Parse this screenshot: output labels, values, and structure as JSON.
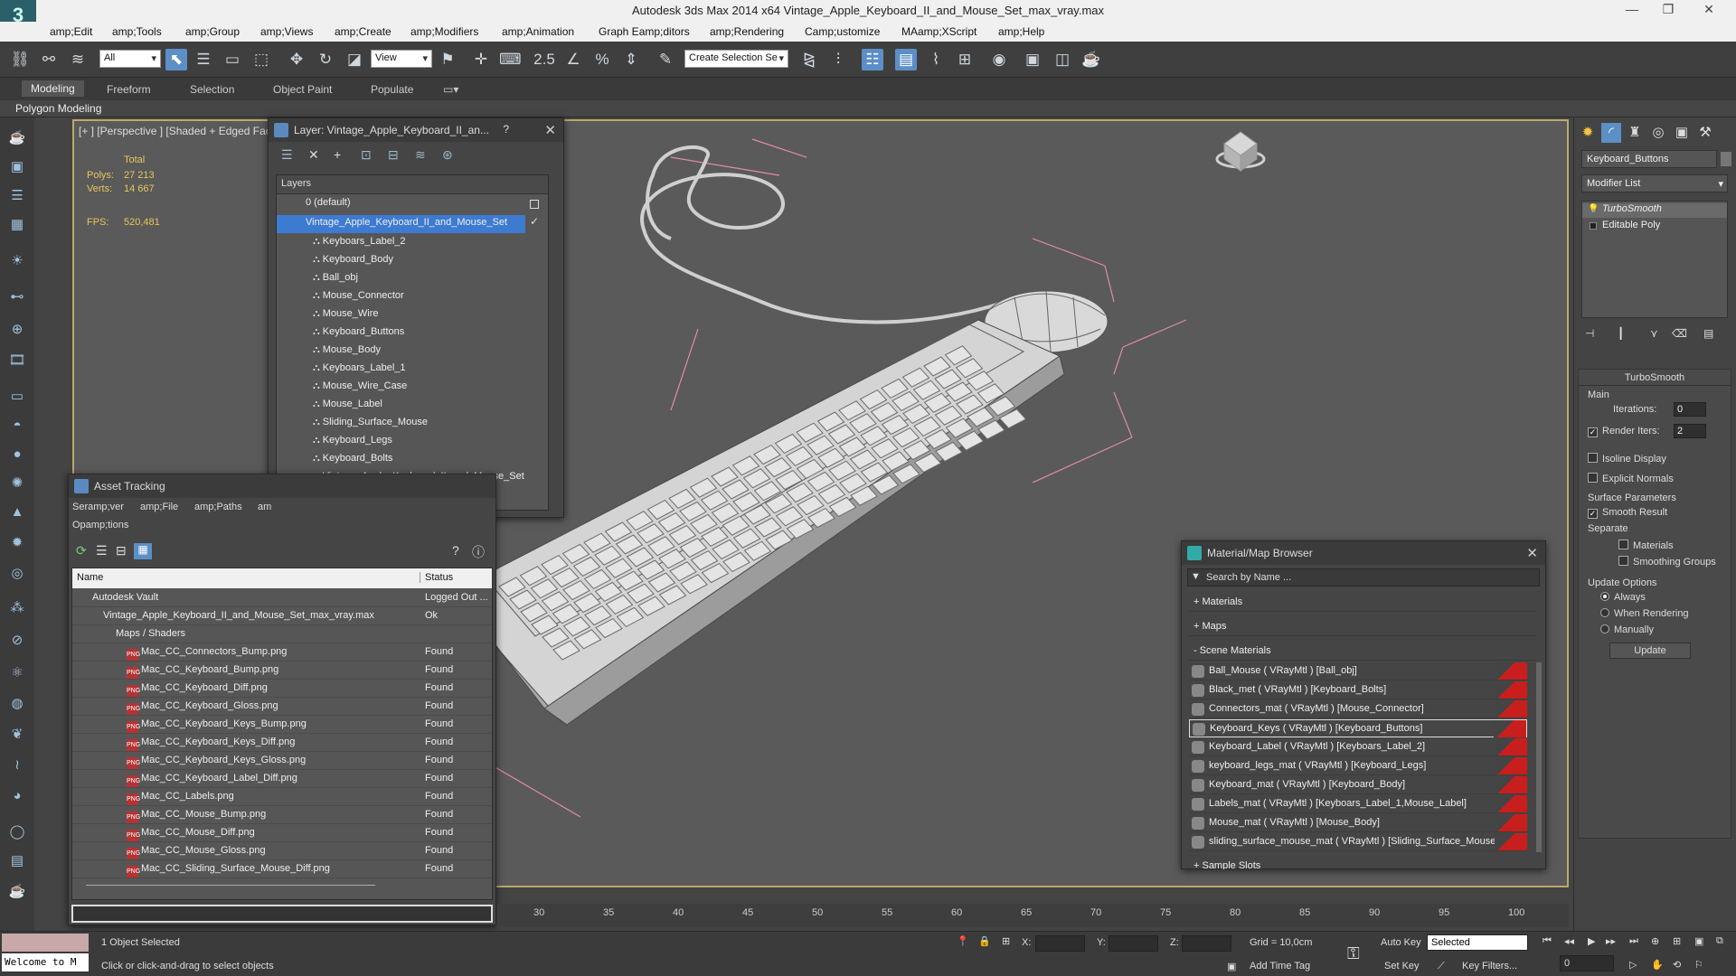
{
  "window": {
    "title": "Autodesk 3ds Max  2014 x64      Vintage_Apple_Keyboard_II_and_Mouse_Set_max_vray.max",
    "logo": "3",
    "min": "—",
    "restore": "❐",
    "close": "✕"
  },
  "menu": [
    "amp;Edit",
    "amp;Tools",
    "amp;Group",
    "amp;Views",
    "amp;Create",
    "amp;Modifiers",
    "amp;Animation",
    "Graph Eamp;ditors",
    "amp;Rendering",
    "Camp;ustomize",
    "MAamp;XScript",
    "amp;Help"
  ],
  "toolbar": {
    "filter_select": "All",
    "refcoord_select": "View",
    "selection_set": "Create Selection Se",
    "snap_angle": "2.5"
  },
  "ribbon": {
    "tabs": [
      "Modeling",
      "Freeform",
      "Selection",
      "Object Paint",
      "Populate"
    ],
    "active_tab": "Modeling",
    "sub_title": "Polygon Modeling"
  },
  "viewport": {
    "label": "[+ ] [Perspective ] [Shaded + Edged Faces ]",
    "stats": {
      "total_label": "Total",
      "polys_label": "Polys:",
      "polys_value": "27 213",
      "verts_label": "Verts:",
      "verts_value": "14 667",
      "fps_label": "FPS:",
      "fps_value": "520,481"
    }
  },
  "layer_dialog": {
    "title": "Layer: Vintage_Apple_Keyboard_II_an...",
    "help": "?",
    "close": "✕",
    "header": "Layers",
    "default_layer": "0 (default)",
    "selected_layer": "Vintage_Apple_Keyboard_II_and_Mouse_Set",
    "objects": [
      "Keyboars_Label_2",
      "Keyboard_Body",
      "Ball_obj",
      "Mouse_Connector",
      "Mouse_Wire",
      "Keyboard_Buttons",
      "Mouse_Body",
      "Keyboars_Label_1",
      "Mouse_Wire_Case",
      "Mouse_Label",
      "Sliding_Surface_Mouse",
      "Keyboard_Legs",
      "Keyboard_Bolts",
      "Vintage_Apple_Keyboard_II_and_Mouse_Set"
    ]
  },
  "asset_tracking": {
    "title": "Asset Tracking",
    "menu": [
      "Seramp;ver",
      "amp;File",
      "amp;Paths",
      "am"
    ],
    "menu2": "Opamp;tions",
    "col_name": "Name",
    "col_status": "Status",
    "rows": [
      {
        "name": "Autodesk Vault",
        "status": "Logged Out ..."
      },
      {
        "name": "Vintage_Apple_Keyboard_II_and_Mouse_Set_max_vray.max",
        "status": "Ok"
      },
      {
        "name": "Maps / Shaders",
        "status": ""
      },
      {
        "name": "Mac_CC_Connectors_Bump.png",
        "status": "Found"
      },
      {
        "name": "Mac_CC_Keyboard_Bump.png",
        "status": "Found"
      },
      {
        "name": "Mac_CC_Keyboard_Diff.png",
        "status": "Found"
      },
      {
        "name": "Mac_CC_Keyboard_Gloss.png",
        "status": "Found"
      },
      {
        "name": "Mac_CC_Keyboard_Keys_Bump.png",
        "status": "Found"
      },
      {
        "name": "Mac_CC_Keyboard_Keys_Diff.png",
        "status": "Found"
      },
      {
        "name": "Mac_CC_Keyboard_Keys_Gloss.png",
        "status": "Found"
      },
      {
        "name": "Mac_CC_Keyboard_Label_Diff.png",
        "status": "Found"
      },
      {
        "name": "Mac_CC_Labels.png",
        "status": "Found"
      },
      {
        "name": "Mac_CC_Mouse_Bump.png",
        "status": "Found"
      },
      {
        "name": "Mac_CC_Mouse_Diff.png",
        "status": "Found"
      },
      {
        "name": "Mac_CC_Mouse_Gloss.png",
        "status": "Found"
      },
      {
        "name": "Mac_CC_Sliding_Surface_Mouse_Diff.png",
        "status": "Found"
      }
    ]
  },
  "material_browser": {
    "title": "Material/Map Browser",
    "search_placeholder": "Search by Name ...",
    "sections": [
      "+ Materials",
      "+ Maps",
      "- Scene Materials"
    ],
    "materials": [
      "Ball_Mouse ( VRayMtl ) [Ball_obj]",
      "Black_met ( VRayMtl ) [Keyboard_Bolts]",
      "Connectors_mat ( VRayMtl ) [Mouse_Connector]",
      "Keyboard_Keys ( VRayMtl ) [Keyboard_Buttons]",
      "Keyboard_Label ( VRayMtl ) [Keyboars_Label_2]",
      "keyboard_legs_mat ( VRayMtl ) [Keyboard_Legs]",
      "Keyboard_mat ( VRayMtl ) [Keyboard_Body]",
      "Labels_mat ( VRayMtl ) [Keyboars_Label_1,Mouse_Label]",
      "Mouse_mat ( VRayMtl ) [Mouse_Body]",
      "sliding_surface_mouse_mat ( VRayMtl ) [Sliding_Surface_Mouse]"
    ],
    "sample_slots": "+ Sample Slots"
  },
  "command_panel": {
    "object_name": "Keyboard_Buttons",
    "modifier_list": "Modifier List",
    "stack": [
      "TurboSmooth",
      "Editable Poly"
    ],
    "turbosmooth_title": "TurboSmooth",
    "main_label": "Main",
    "iterations_label": "Iterations:",
    "iterations_value": "0",
    "render_iters_label": "Render Iters:",
    "render_iters_value": "2",
    "isoline": "Isoline Display",
    "explicit": "Explicit Normals",
    "surface_params": "Surface Parameters",
    "smooth_result": "Smooth Result",
    "separate": "Separate",
    "materials": "Materials",
    "smoothing_groups": "Smoothing Groups",
    "update_options": "Update Options",
    "always": "Always",
    "when_rendering": "When Rendering",
    "manually": "Manually",
    "update_btn": "Update"
  },
  "timeline": {
    "ticks": [
      "30",
      "35",
      "40",
      "45",
      "50",
      "55",
      "60",
      "65",
      "70",
      "75",
      "80",
      "85",
      "90",
      "95",
      "100"
    ]
  },
  "status": {
    "maxscript": "Welcome to M",
    "selected": "1 Object Selected",
    "hint": "Click or click-and-drag to select objects",
    "x_label": "X:",
    "y_label": "Y:",
    "z_label": "Z:",
    "grid": "Grid = 10,0cm",
    "add_time_tag": "Add Time Tag",
    "auto_key": "Auto Key",
    "auto_key_select": "Selected",
    "set_key": "Set Key",
    "key_filters": "Key Filters...",
    "frame": "0"
  }
}
